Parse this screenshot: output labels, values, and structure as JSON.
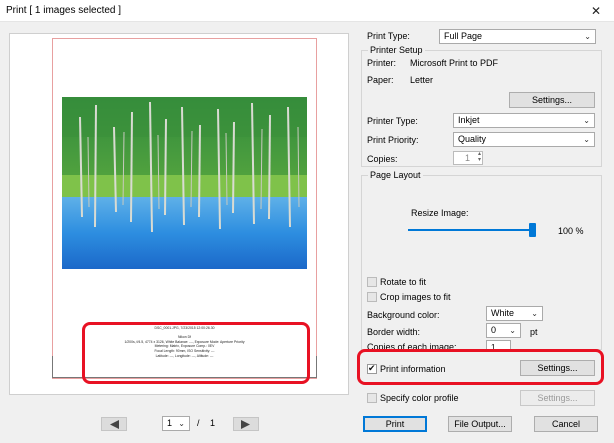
{
  "window": {
    "title": "Print [ 1 images selected ]"
  },
  "preview": {
    "info_lines": [
      "DSC_0001.JPG, 7/23/2015 12:00:26.30",
      "",
      "Nikon Df",
      "1/200s, f/4.5, 4774 x 3126, White Balance: ---, Exposure Mode: Aperture Priority",
      "Metering: Matrix, Exposure Comp.: 0EV",
      "Focal Length: 90mm, ISO Sensitivity: ---",
      "Latitude: ---, Longitude: ---, Altitude: ---"
    ],
    "page_current": "1",
    "page_sep": "/",
    "page_total": "1"
  },
  "settings": {
    "print_type_label": "Print Type:",
    "print_type_value": "Full Page",
    "printer_setup_title": "Printer Setup",
    "printer_label": "Printer:",
    "printer_value": "Microsoft Print to PDF",
    "paper_label": "Paper:",
    "paper_value": "Letter",
    "settings_button": "Settings...",
    "printer_type_label": "Printer Type:",
    "printer_type_value": "Inkjet",
    "print_priority_label": "Print Priority:",
    "print_priority_value": "Quality",
    "copies_label": "Copies:",
    "copies_value": "1",
    "page_layout_title": "Page Layout",
    "resize_label": "Resize Image:",
    "resize_value": "100 %",
    "resize_percent": 100,
    "rotate_label": "Rotate to fit",
    "crop_label": "Crop images to fit",
    "background_label": "Background color:",
    "background_value": "White",
    "border_label": "Border width:",
    "border_value": "0",
    "border_unit": "pt",
    "copies_each_label": "Copies of each image:",
    "copies_each_value": "1",
    "print_info_label": "Print information",
    "print_info_settings": "Settings...",
    "profile_label": "Specify color profile",
    "profile_settings": "Settings..."
  },
  "footer": {
    "print": "Print",
    "file_output": "File Output...",
    "cancel": "Cancel"
  },
  "colors": {
    "accent": "#0078d7",
    "highlight": "#e81123"
  }
}
